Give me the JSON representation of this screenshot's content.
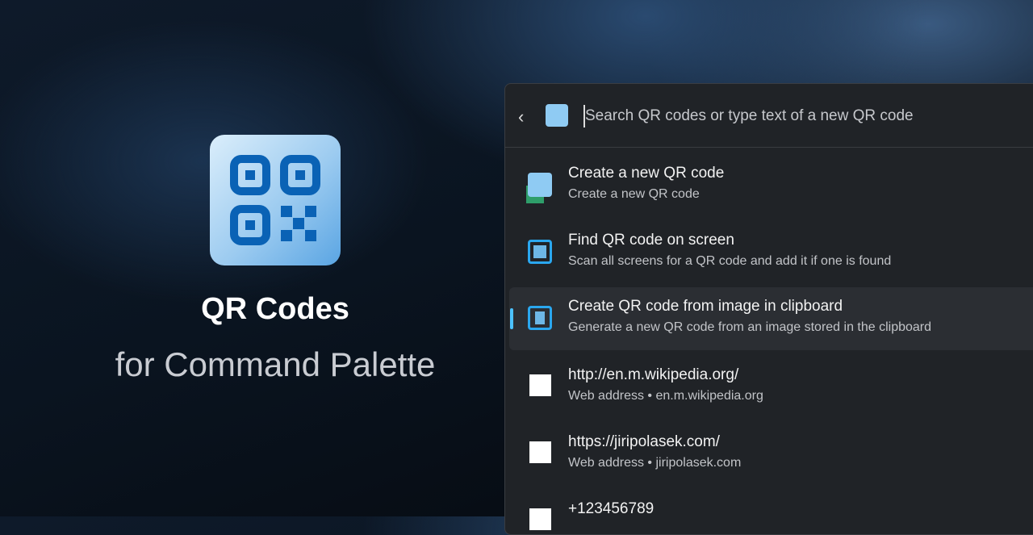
{
  "hero": {
    "title": "QR Codes",
    "subtitle": "for Command Palette"
  },
  "search": {
    "placeholder": "Search QR codes or type text of a new QR code",
    "value": ""
  },
  "items": [
    {
      "title": "Create a new QR code",
      "subtitle": "Create a new QR code",
      "icon": "qr-add-icon"
    },
    {
      "title": "Find QR code on screen",
      "subtitle": "Scan all screens for a QR code and add it if one is found",
      "icon": "screen-scan-icon"
    },
    {
      "title": "Create QR code from image in clipboard",
      "subtitle": "Generate a new QR code from an image stored in the clipboard",
      "icon": "clipboard-scan-icon",
      "selected": true
    },
    {
      "title": "http://en.m.wikipedia.org/",
      "subtitle": "Web address • en.m.wikipedia.org",
      "icon": "qr-code-icon"
    },
    {
      "title": "https://jiripolasek.com/",
      "subtitle": "Web address • jiripolasek.com",
      "icon": "qr-code-icon"
    },
    {
      "title": "+123456789",
      "subtitle": "",
      "icon": "qr-code-icon"
    }
  ],
  "colors": {
    "accent": "#4cc2ff",
    "panel": "#202327"
  }
}
